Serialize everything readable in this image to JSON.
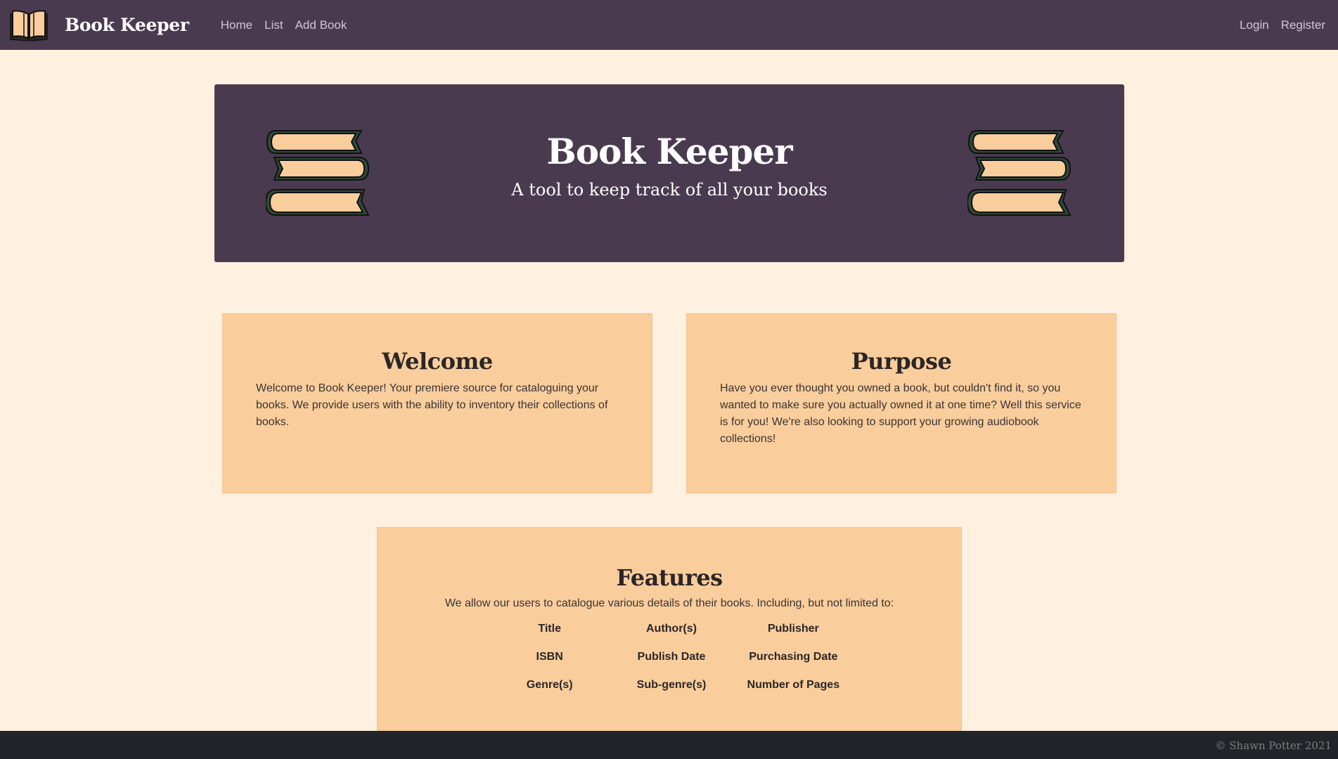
{
  "navbar": {
    "brand": "Book Keeper",
    "logo_icon": "open-book-icon",
    "links": [
      "Home",
      "List",
      "Add Book"
    ],
    "right_links": [
      "Login",
      "Register"
    ]
  },
  "hero": {
    "title": "Book Keeper",
    "subtitle": "A tool to keep track of all your books",
    "icon": "book-stack-icon"
  },
  "welcome": {
    "title": "Welcome",
    "body": "Welcome to Book Keeper! Your premiere source for cataloguing your books. We provide users with the ability to inventory their collections of books."
  },
  "purpose": {
    "title": "Purpose",
    "body": "Have you ever thought you owned a book, but couldn't find it, so you wanted to make sure you actually owned it at one time? Well this service is for you! We're also looking to support your growing audiobook collections!"
  },
  "features": {
    "title": "Features",
    "intro": "We allow our users to catalogue various details of their books. Including, but not limited to:",
    "items": [
      "Title",
      "Author(s)",
      "Publisher",
      "ISBN",
      "Publish Date",
      "Purchasing Date",
      "Genre(s)",
      "Sub-genre(s)",
      "Number of Pages"
    ]
  },
  "footer": {
    "text": "© Shawn Potter 2021"
  },
  "colors": {
    "navbar_bg": "#4a3a4f",
    "page_bg": "#fff0df",
    "card_bg": "#f9cd9c",
    "book_page": "#f9cd9c",
    "book_cover": "#2f4a38",
    "footer_bg": "#212529"
  }
}
